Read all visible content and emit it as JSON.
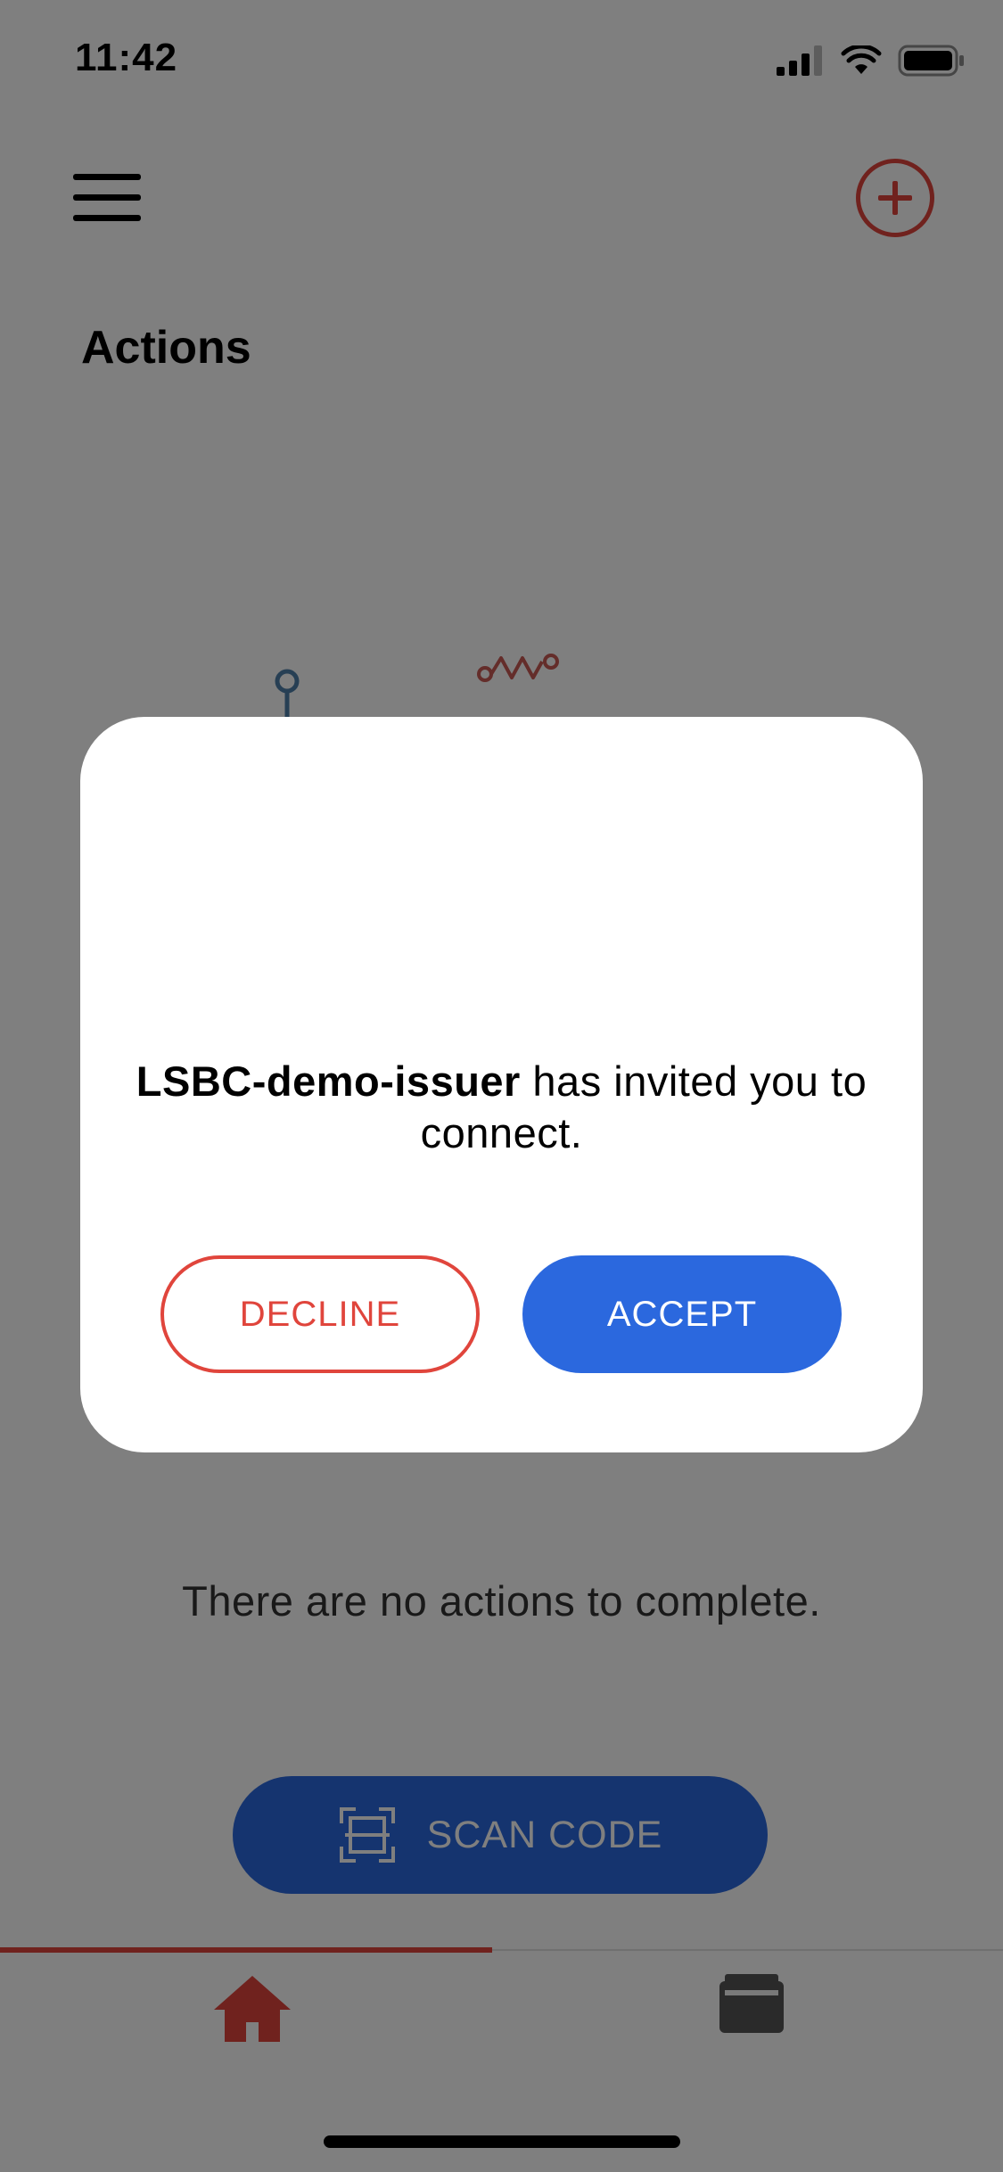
{
  "status_bar": {
    "time": "11:42"
  },
  "header": {
    "menu_icon": "hamburger-icon",
    "add_icon": "plus-circle-icon"
  },
  "page": {
    "title": "Actions",
    "empty_message": "There are no actions to complete."
  },
  "scan_button": {
    "label": "SCAN CODE",
    "icon": "scan-frame-icon"
  },
  "tab_bar": {
    "tabs": [
      {
        "icon": "home-icon",
        "active": true
      },
      {
        "icon": "wallet-icon",
        "active": false
      }
    ]
  },
  "modal": {
    "issuer": "LSBC-demo-issuer",
    "message": " has invited you to connect.",
    "decline_label": "DECLINE",
    "accept_label": "ACCEPT"
  },
  "colors": {
    "accent_red": "#e0453c",
    "primary_blue": "#2b68de",
    "overlay": "rgba(0,0,0,0.5)"
  }
}
